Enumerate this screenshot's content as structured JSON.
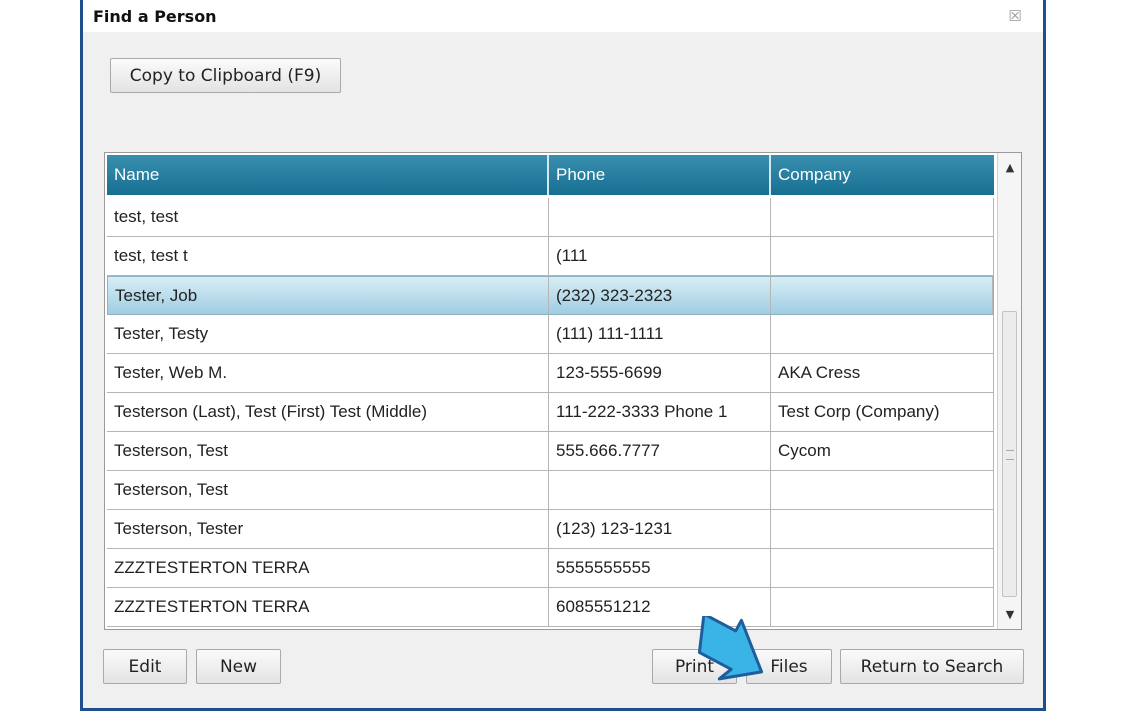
{
  "window": {
    "title": "Find a Person"
  },
  "toolbar": {
    "copy_label": "Copy to Clipboard (F9)"
  },
  "grid": {
    "columns": [
      "Name",
      "Phone",
      "Company"
    ],
    "rows": [
      [
        "test, test",
        "",
        ""
      ],
      [
        "test, test t",
        "(111",
        ""
      ],
      [
        "Tester, Job",
        "(232) 323-2323",
        ""
      ],
      [
        "Tester, Testy",
        "(111) 111-1111",
        ""
      ],
      [
        "Tester, Web M.",
        "123-555-6699",
        "AKA Cress"
      ],
      [
        "Testerson (Last), Test (First) Test (Middle)",
        "111-222-3333 Phone 1",
        "Test Corp (Company)"
      ],
      [
        "Testerson, Test",
        "555.666.7777",
        "Cycom"
      ],
      [
        "Testerson, Test",
        "",
        ""
      ],
      [
        "Testerson, Tester",
        "(123) 123-1231",
        ""
      ],
      [
        "ZZZTESTERTON TERRA",
        "5555555555",
        ""
      ],
      [
        "ZZZTESTERTON TERRA",
        "6085551212",
        ""
      ]
    ],
    "selected_index": 2
  },
  "footer": {
    "edit_label": "Edit",
    "new_label": "New",
    "print_label": "Print",
    "files_label": "Files",
    "return_label": "Return to Search"
  },
  "icons": {
    "close": "close-icon",
    "scroll_up": "chevron-up-icon",
    "scroll_down": "chevron-down-icon",
    "pointer": "arrow-pointer-icon"
  },
  "colors": {
    "header": "#166f92",
    "selection": "#9fcde2",
    "frame": "#1f4e8c",
    "pointer": "#3ab4e6"
  }
}
